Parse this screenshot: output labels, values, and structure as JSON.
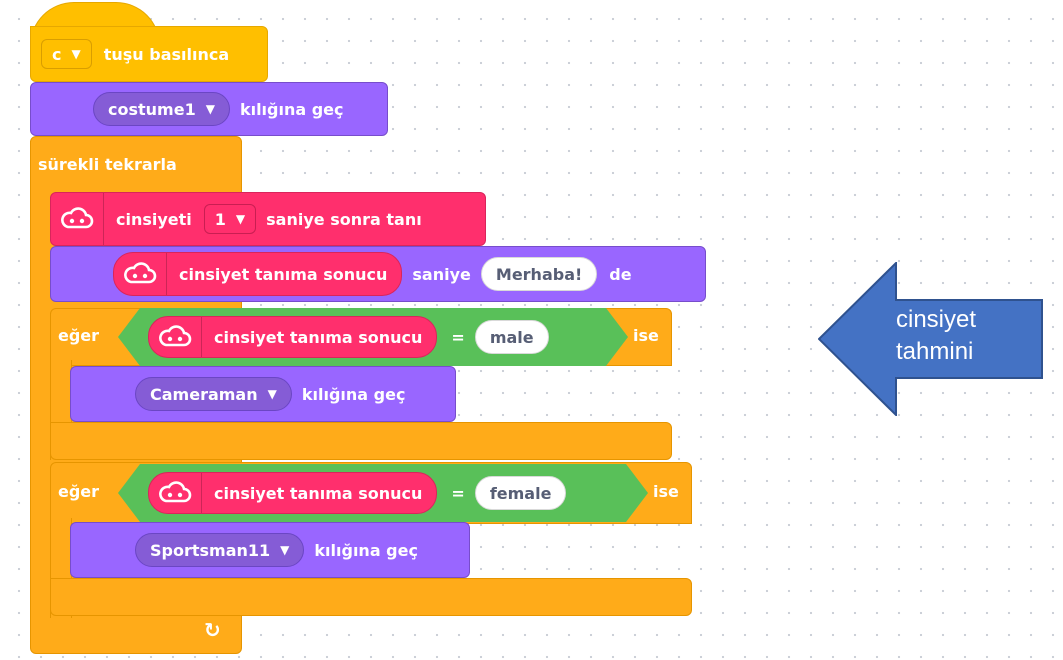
{
  "event": {
    "key": "c",
    "label": "tuşu basılınca"
  },
  "switch1": {
    "costume": "costume1",
    "label": "kılığına geç"
  },
  "forever": {
    "label": "sürekli tekrarla",
    "loop_symbol": "↻"
  },
  "recognize": {
    "label": "cinsiyeti",
    "seconds": "1",
    "suffix": "saniye sonra tanı"
  },
  "say": {
    "reporter": "cinsiyet tanıma sonucu",
    "mid": "saniye",
    "text": "Merhaba!",
    "end": "de"
  },
  "if1": {
    "prefix": "eğer",
    "reporter": "cinsiyet tanıma sonucu",
    "operator": "=",
    "value": "male",
    "suffix": "ise",
    "costume": "Cameraman",
    "costume_label": "kılığına geç"
  },
  "if2": {
    "prefix": "eğer",
    "reporter": "cinsiyet tanıma sonucu",
    "operator": "=",
    "value": "female",
    "suffix": "ise",
    "costume": "Sportsman11",
    "costume_label": "kılığına geç"
  },
  "callout": {
    "line1": "cinsiyet",
    "line2": "tahmini",
    "color": "#4472c4"
  },
  "colors": {
    "events": "#ffbf00",
    "looks": "#9966ff",
    "control": "#ffab19",
    "extension": "#ff2f6d",
    "operators": "#59c059"
  },
  "icons": {
    "extension": "cloud-ai-icon",
    "dropdown": "caret-down-icon",
    "loop": "loop-arrow-icon"
  }
}
